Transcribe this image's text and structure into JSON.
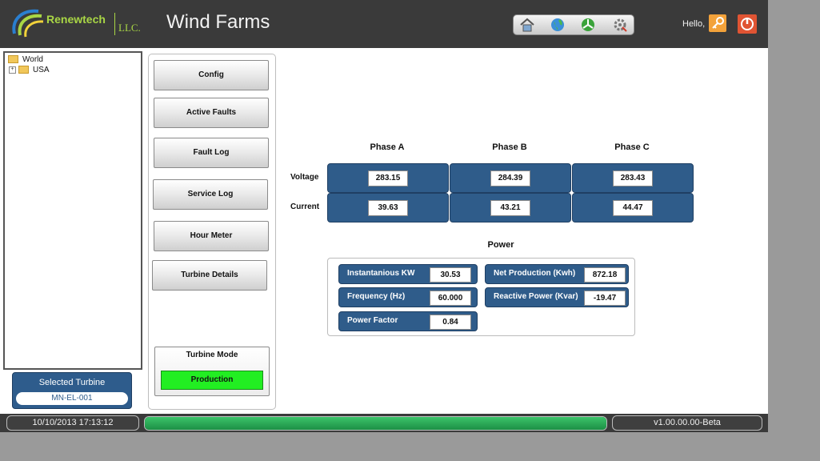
{
  "header": {
    "brand": "Renewtech",
    "brand_suffix": "LLC.",
    "title": "Wind Farms",
    "greeting": "Hello,",
    "nav_icons": [
      "home-icon",
      "globe-icon",
      "turbine-icon",
      "settings-icon"
    ]
  },
  "tree": {
    "root": "World",
    "child": "USA"
  },
  "menu": {
    "config": "Config",
    "active_faults": "Active Faults",
    "fault_log": "Fault Log",
    "service_log": "Service Log",
    "hour_meter": "Hour Meter",
    "turbine_details": "Turbine Details"
  },
  "turbine_mode": {
    "label": "Turbine Mode",
    "value": "Production",
    "color": "#22ee22"
  },
  "selected_turbine": {
    "label": "Selected Turbine",
    "value": "MN-EL-001"
  },
  "phases": {
    "headers": [
      "Phase A",
      "Phase B",
      "Phase C"
    ],
    "voltage_label": "Voltage",
    "current_label": "Current",
    "voltage": [
      "283.15",
      "284.39",
      "283.43"
    ],
    "current": [
      "39.63",
      "43.21",
      "44.47"
    ]
  },
  "power": {
    "title": "Power",
    "instantaneous_kw": {
      "label": "Instantanious KW",
      "value": "30.53"
    },
    "frequency": {
      "label": "Frequency (Hz)",
      "value": "60.000"
    },
    "power_factor": {
      "label": "Power Factor",
      "value": "0.84"
    },
    "net_production": {
      "label": "Net Production (Kwh)",
      "value": "872.18"
    },
    "reactive_power": {
      "label": "Reactive Power (Kvar)",
      "value": "-19.47"
    }
  },
  "status": {
    "datetime": "10/10/2013 17:13:12",
    "progress": 1.0,
    "version": "v1.00.00.00-Beta"
  },
  "colors": {
    "accent_blue": "#2f5c8a",
    "brand_green": "#a9d645",
    "status_green": "#2aa857"
  }
}
